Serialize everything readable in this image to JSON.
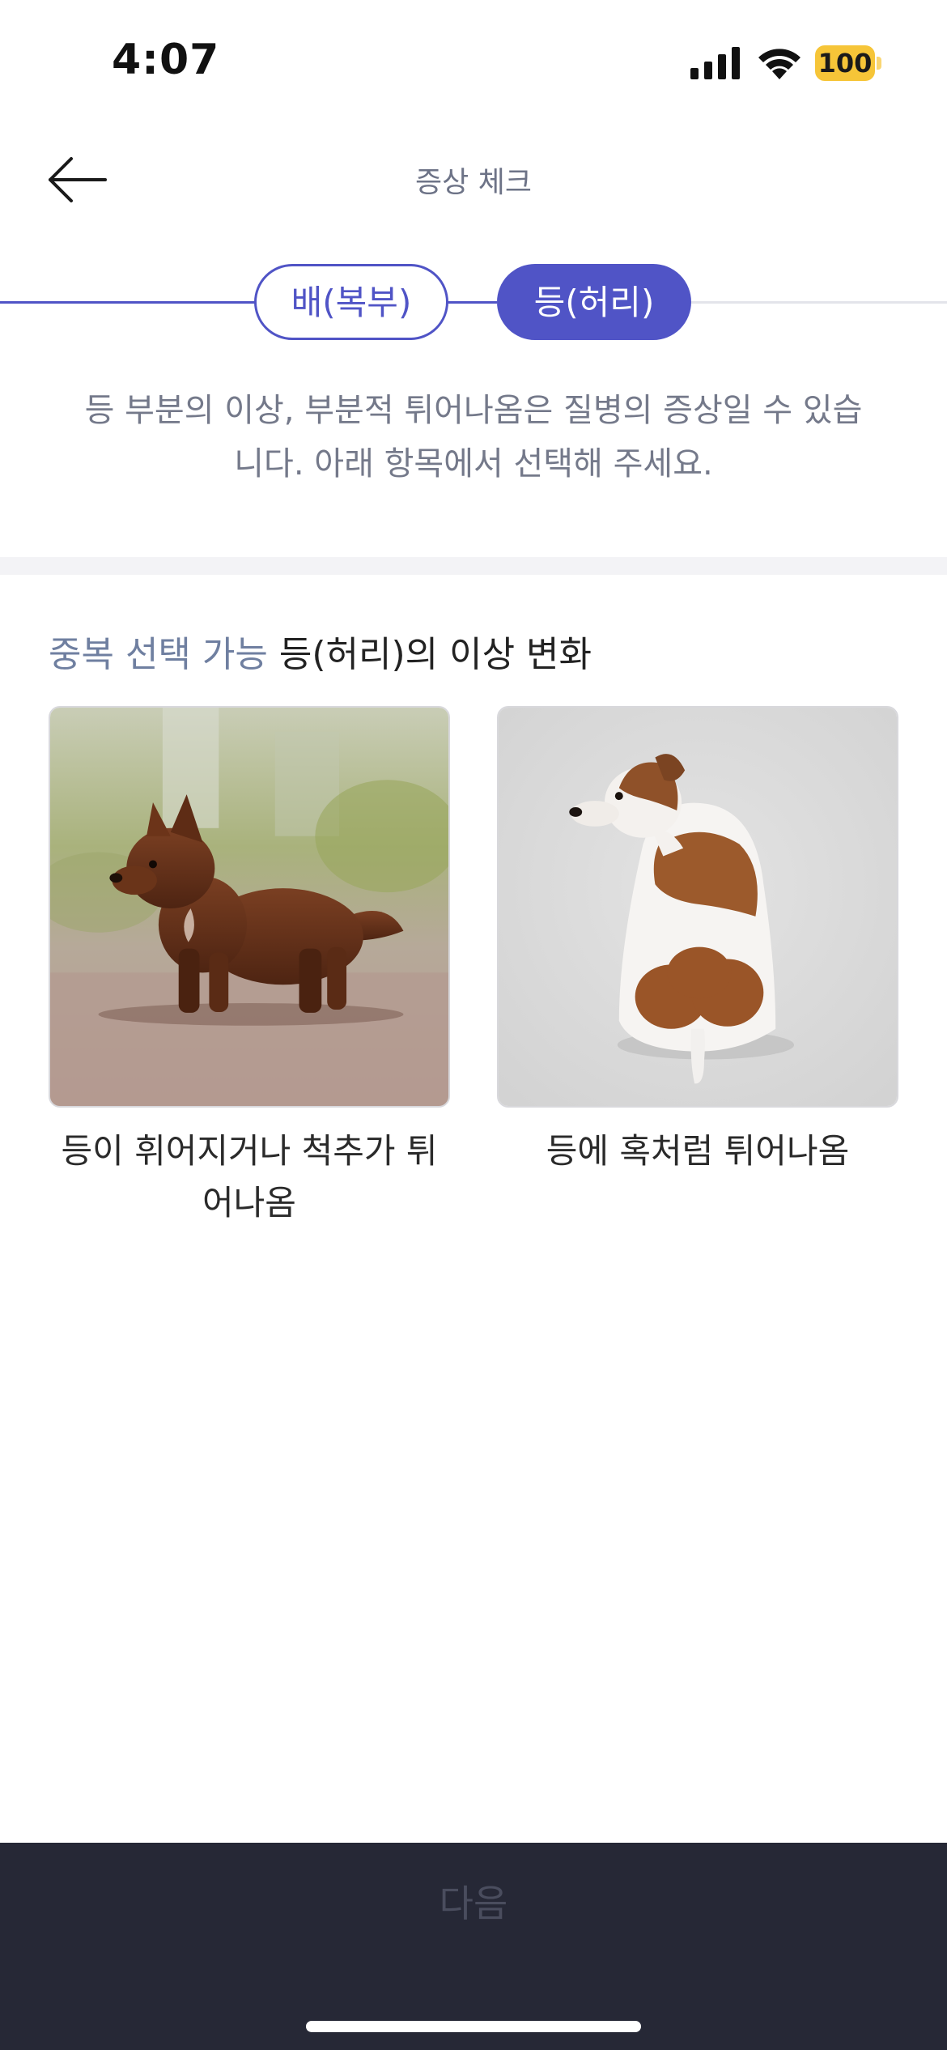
{
  "status_bar": {
    "time": "4:07",
    "battery": "100"
  },
  "header": {
    "title": "증상 체크"
  },
  "steps": [
    {
      "label": "배(복부)",
      "state": "completed"
    },
    {
      "label": "등(허리)",
      "state": "active"
    }
  ],
  "description": "등 부분의 이상, 부분적 튀어나옴은 질병의 증상일 수 있습니다. 아래 항목에서 선택해 주세요.",
  "section": {
    "hint": "중복 선택 가능",
    "title": "등(허리)의 이상 변화"
  },
  "options": [
    {
      "label": "등이 휘어지거나 척추가 튀어나옴",
      "image": "brown-puppy-standing-photo"
    },
    {
      "label": "등에 혹처럼 튀어나옴",
      "image": "jack-russell-sitting-back-view-photo"
    }
  ],
  "bottom": {
    "next_label": "다음"
  },
  "colors": {
    "accent": "#5054c6",
    "bottom_bar": "#262836",
    "battery": "#f6c538",
    "hint": "#6f7fa0"
  }
}
